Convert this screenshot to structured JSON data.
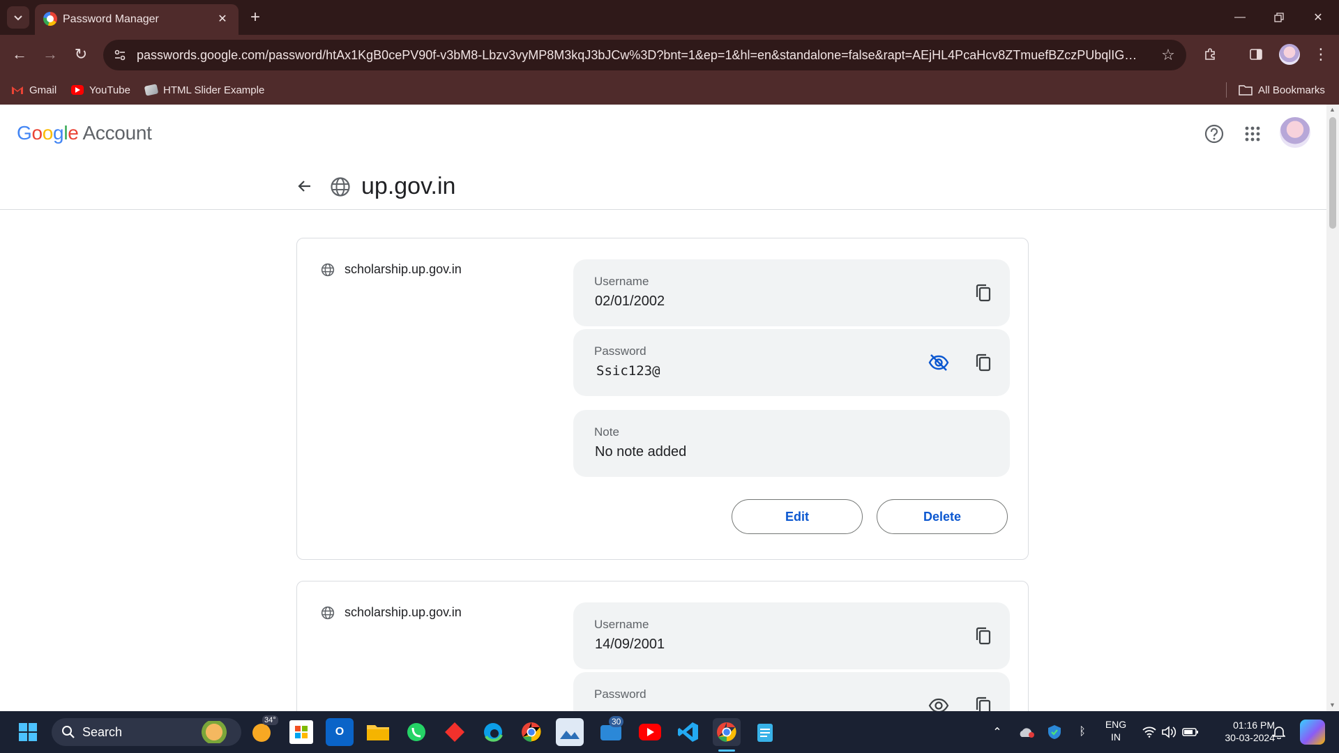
{
  "browser": {
    "tab_title": "Password Manager",
    "url": "passwords.google.com/password/htAx1KgB0cePV90f-v3bM8-Lbzv3vyMP8M3kqJ3bJCw%3D?bnt=1&ep=1&hl=en&standalone=false&rapt=AEjHL4PcaHcv8ZTmuefBZczPUbqlIG0yFQGBGR...",
    "bookmarks": [
      {
        "label": "Gmail",
        "icon": "gmail-icon",
        "color": "#ea4335"
      },
      {
        "label": "YouTube",
        "icon": "youtube-icon",
        "color": "#ff0000"
      },
      {
        "label": "HTML Slider Example",
        "icon": "page-icon",
        "color": "#9aa0a6"
      }
    ],
    "all_bookmarks_label": "All Bookmarks"
  },
  "header": {
    "logo_google": "Google",
    "logo_account": "Account",
    "logo_colors": [
      "#4285f4",
      "#ea4335",
      "#fbbc05",
      "#4285f4",
      "#34a853",
      "#ea4335"
    ]
  },
  "site": {
    "title": "up.gov.in"
  },
  "entries": [
    {
      "origin": "scholarship.up.gov.in",
      "username_label": "Username",
      "username": "02/01/2002",
      "password_label": "Password",
      "password": "Ssic123@",
      "password_visible": true,
      "note_label": "Note",
      "note": "No note added",
      "edit_label": "Edit",
      "delete_label": "Delete"
    },
    {
      "origin": "scholarship.up.gov.in",
      "username_label": "Username",
      "username": "14/09/2001",
      "password_label": "Password",
      "password_visible": false
    }
  ],
  "taskbar": {
    "search_label": "Search",
    "weather_temp": "34°",
    "mail_badge": "30",
    "language": "ENG",
    "region": "IN",
    "time": "01:16 PM",
    "date": "30-03-2024"
  },
  "colors": {
    "accent": "#0b57d0",
    "browser_frame": "#4f2b2b"
  }
}
